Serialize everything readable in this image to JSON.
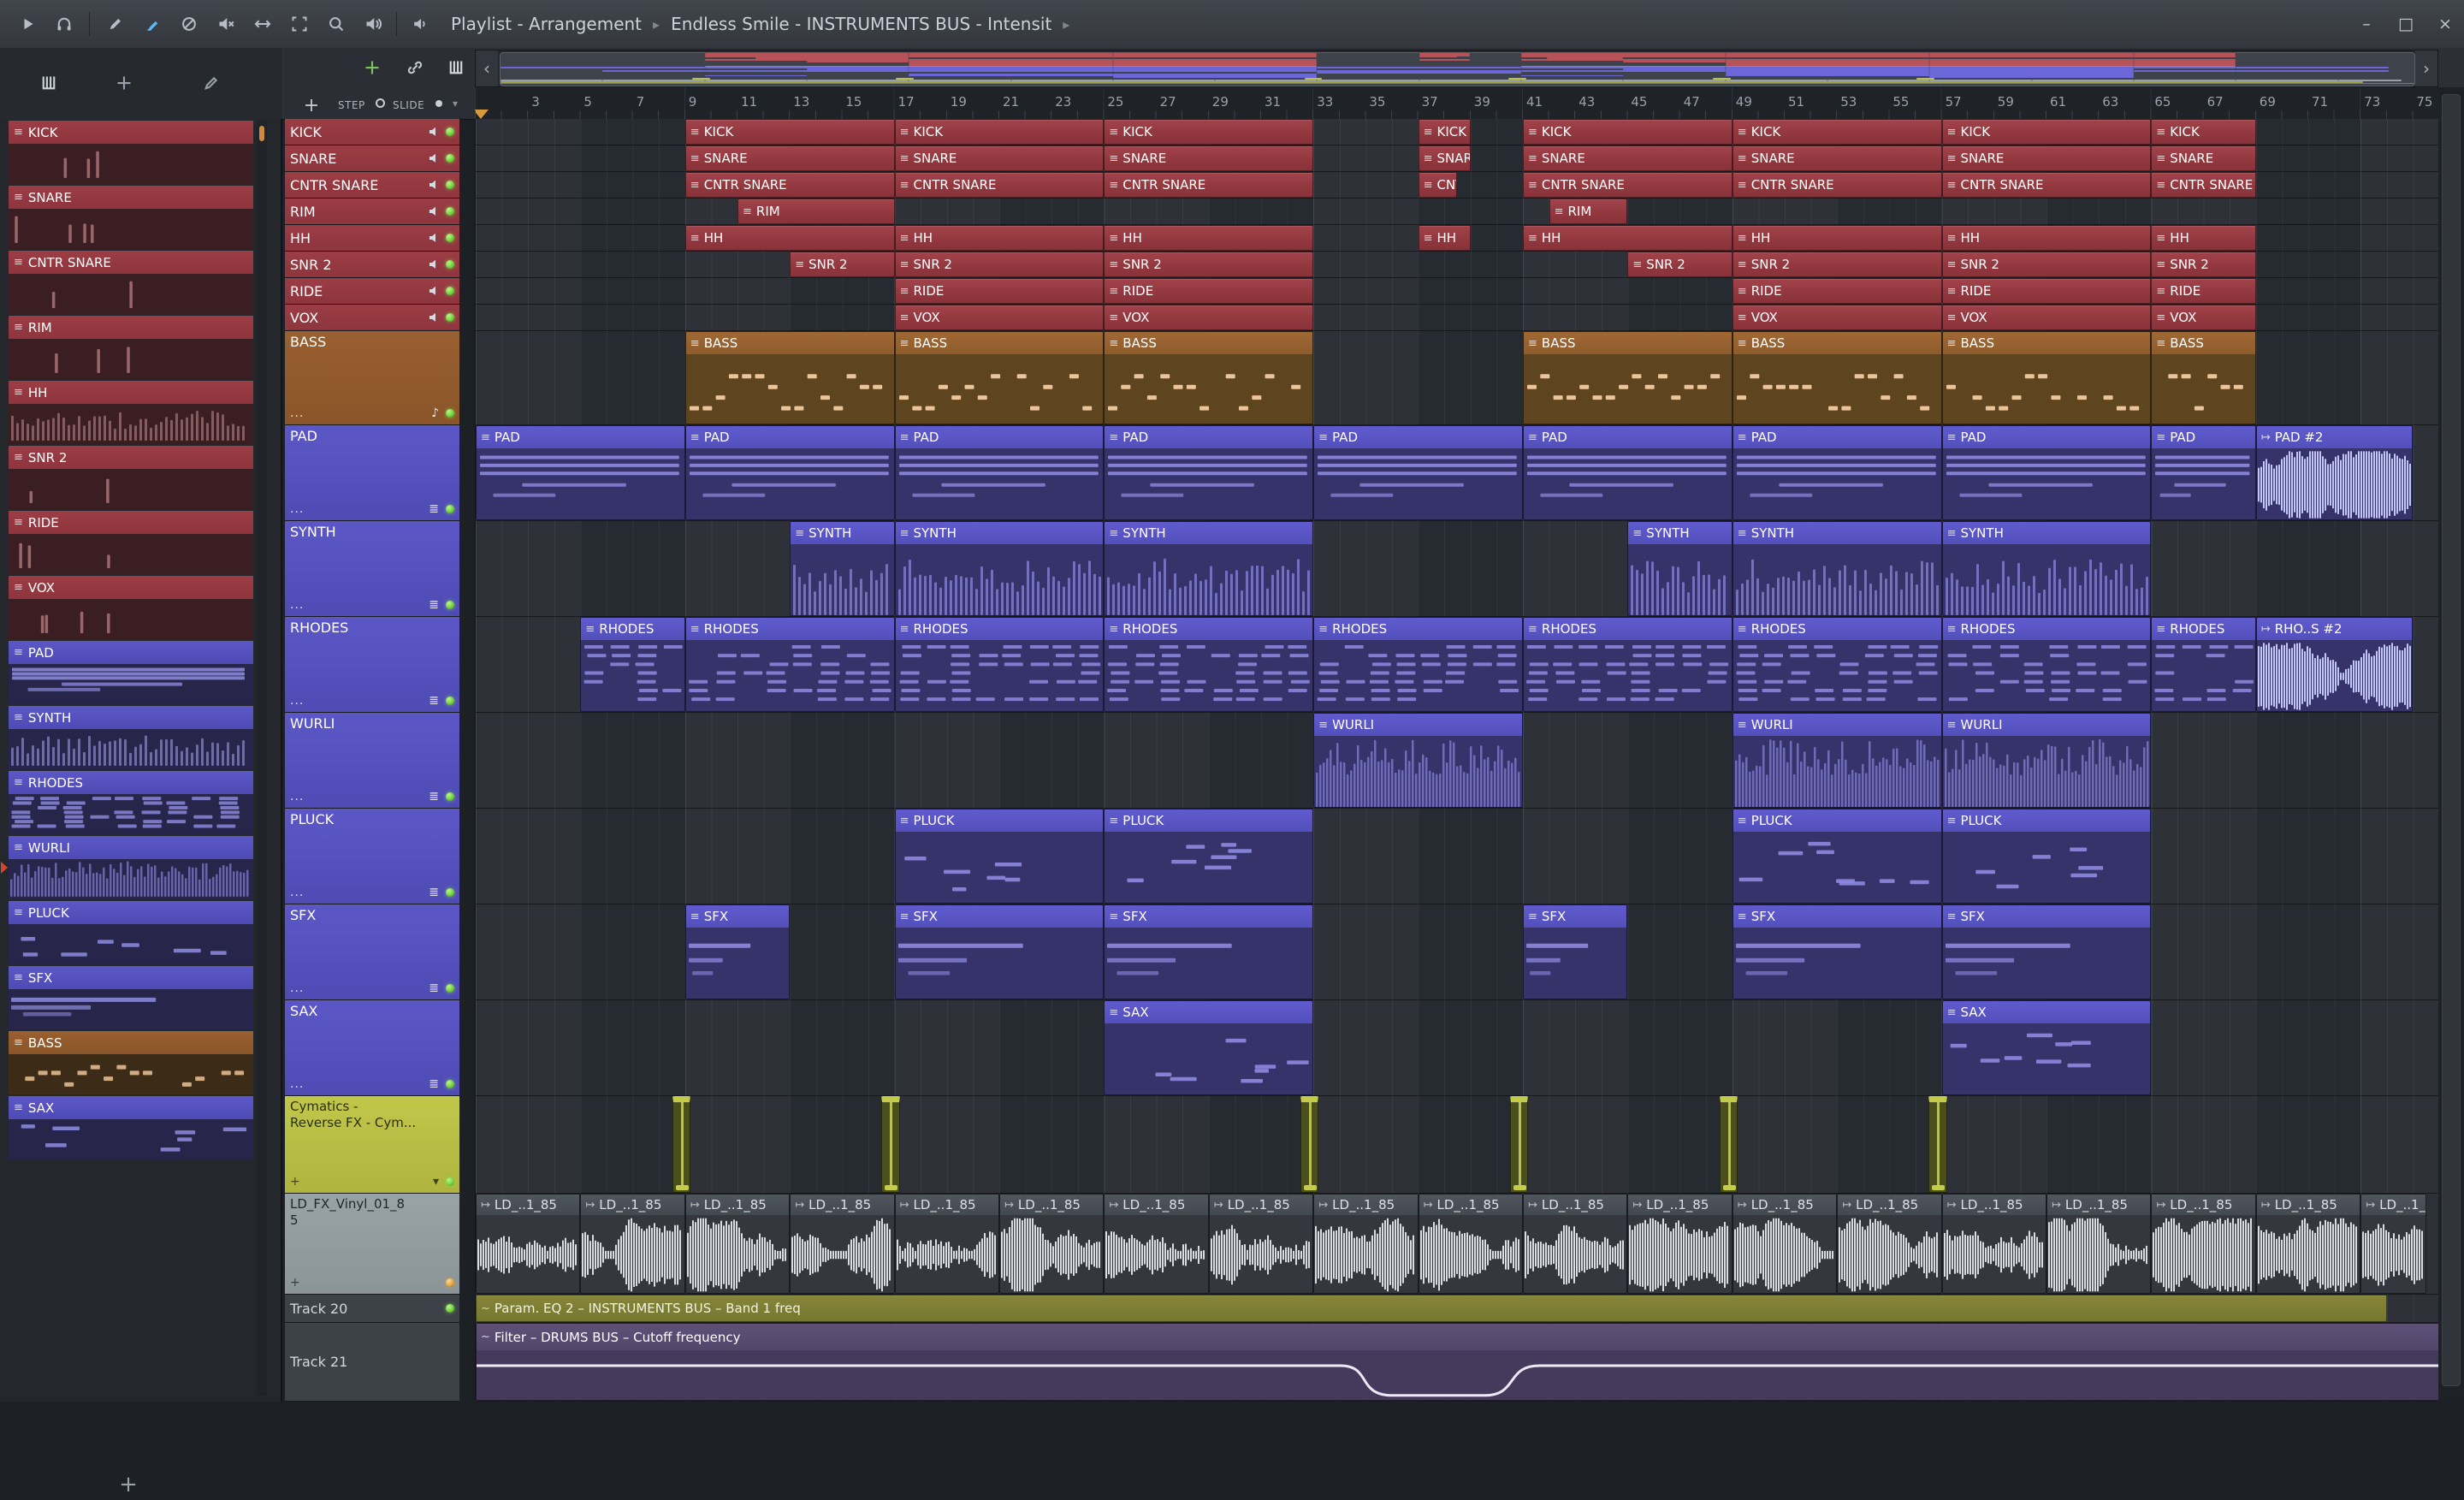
{
  "window": {
    "title_left": "Playlist - Arrangement",
    "title_mid": "Endless Smile - INSTRUMENTS BUS - Intensit",
    "chevron": "▸",
    "minimize": "–",
    "maximize": "□",
    "close": "×"
  },
  "nav": {
    "left": "‹",
    "right": "›",
    "up": "▴"
  },
  "pl_toolbar": {
    "add": "+",
    "step": "STEP",
    "slide": "SLIDE"
  },
  "timeline": {
    "numbers": [
      3,
      5,
      7,
      9,
      11,
      13,
      15,
      17,
      19,
      21,
      23,
      25,
      27,
      29,
      31,
      33,
      35,
      37,
      39,
      41,
      43,
      45,
      47,
      49,
      51,
      53,
      55,
      57,
      59,
      61,
      63,
      65,
      67,
      69,
      71,
      73,
      75
    ]
  },
  "sidebar": {
    "add_button": "+",
    "selected_item": "WURLI",
    "items": [
      {
        "name": "KICK",
        "kind": "red",
        "pv": "hits"
      },
      {
        "name": "SNARE",
        "kind": "red",
        "pv": "hits"
      },
      {
        "name": "CNTR SNARE",
        "kind": "red",
        "pv": "hits"
      },
      {
        "name": "RIM",
        "kind": "red",
        "pv": "hits"
      },
      {
        "name": "HH",
        "kind": "red",
        "pv": "ticks"
      },
      {
        "name": "SNR 2",
        "kind": "red",
        "pv": "hits"
      },
      {
        "name": "RIDE",
        "kind": "red",
        "pv": "hits"
      },
      {
        "name": "VOX",
        "kind": "red",
        "pv": "hits"
      },
      {
        "name": "PAD",
        "kind": "blue",
        "pv": "pad"
      },
      {
        "name": "SYNTH",
        "kind": "blue",
        "pv": "ticks"
      },
      {
        "name": "RHODES",
        "kind": "blue",
        "pv": "chords"
      },
      {
        "name": "WURLI",
        "kind": "blue",
        "pv": "dense"
      },
      {
        "name": "PLUCK",
        "kind": "blue",
        "pv": "sparse"
      },
      {
        "name": "SFX",
        "kind": "blue",
        "pv": "long"
      },
      {
        "name": "BASS",
        "kind": "brown",
        "pv": "bass"
      },
      {
        "name": "SAX",
        "kind": "blue",
        "pv": "sparse"
      }
    ]
  },
  "tracks": [
    {
      "name": "KICK",
      "kind": "drum",
      "h": 31,
      "led": true
    },
    {
      "name": "SNARE",
      "kind": "drum",
      "h": 31,
      "led": true
    },
    {
      "name": "CNTR SNARE",
      "kind": "drum",
      "h": 31,
      "led": true
    },
    {
      "name": "RIM",
      "kind": "drum",
      "h": 31,
      "led": true
    },
    {
      "name": "HH",
      "kind": "drum",
      "h": 31,
      "led": true
    },
    {
      "name": "SNR 2",
      "kind": "drum",
      "h": 31,
      "led": true
    },
    {
      "name": "RIDE",
      "kind": "drum",
      "h": 31,
      "led": true
    },
    {
      "name": "VOX",
      "kind": "drum",
      "h": 31,
      "led": true
    },
    {
      "name": "BASS",
      "kind": "bass",
      "h": 110,
      "led": true,
      "icon": "♪",
      "dots": "...",
      "clip_pv": "bass"
    },
    {
      "name": "PAD",
      "kind": "keys",
      "h": 112,
      "led": true,
      "icon": "≣",
      "dots": "...",
      "clip_pv": "pad"
    },
    {
      "name": "SYNTH",
      "kind": "keys",
      "h": 112,
      "led": true,
      "icon": "≣",
      "dots": "...",
      "clip_pv": "ticks"
    },
    {
      "name": "RHODES",
      "kind": "keys",
      "h": 112,
      "led": true,
      "icon": "≣",
      "dots": "...",
      "clip_pv": "chords"
    },
    {
      "name": "WURLI",
      "kind": "keys",
      "h": 112,
      "led": true,
      "icon": "≣",
      "dots": "...",
      "clip_pv": "dense"
    },
    {
      "name": "PLUCK",
      "kind": "keys",
      "h": 112,
      "led": true,
      "icon": "≣",
      "dots": "...",
      "clip_pv": "sparse"
    },
    {
      "name": "SFX",
      "kind": "keys",
      "h": 112,
      "led": true,
      "icon": "≣",
      "dots": "...",
      "clip_pv": "long"
    },
    {
      "name": "SAX",
      "kind": "keys",
      "h": 112,
      "led": true,
      "icon": "≣",
      "dots": "...",
      "clip_pv": "sparse"
    },
    {
      "name": "Cymatics - Reverse FX - Cym...",
      "label_lines": [
        "Cymatics -",
        "Reverse FX - Cym..."
      ],
      "kind": "cym",
      "h": 114,
      "led": true,
      "icon": "▾",
      "dots": "+",
      "clip_label": ""
    },
    {
      "name": "LD_FX_Vinyl_01_85",
      "label_lines": [
        "LD_FX_Vinyl_01_8",
        "5"
      ],
      "kind": "ld",
      "h": 118,
      "led": true,
      "led_color": "orange",
      "dots": "+",
      "clip_label": "LD_..1_85",
      "clip_pv": "wave"
    },
    {
      "name": "Track 20",
      "kind": "auto",
      "h": 33,
      "led": true
    },
    {
      "name": "Track 21",
      "kind": "auto",
      "h": 92,
      "led": false
    }
  ],
  "clips": [
    {
      "t": 0,
      "s": 9,
      "e": 17
    },
    {
      "t": 0,
      "s": 17,
      "e": 25
    },
    {
      "t": 0,
      "s": 25,
      "e": 33
    },
    {
      "t": 0,
      "s": 37,
      "e": 39
    },
    {
      "t": 0,
      "s": 41,
      "e": 49
    },
    {
      "t": 0,
      "s": 49,
      "e": 57
    },
    {
      "t": 0,
      "s": 57,
      "e": 65
    },
    {
      "t": 0,
      "s": 65,
      "e": 69
    },
    {
      "t": 1,
      "s": 9,
      "e": 17
    },
    {
      "t": 1,
      "s": 17,
      "e": 25
    },
    {
      "t": 1,
      "s": 25,
      "e": 33
    },
    {
      "t": 1,
      "s": 37,
      "e": 39
    },
    {
      "t": 1,
      "s": 41,
      "e": 49
    },
    {
      "t": 1,
      "s": 49,
      "e": 57
    },
    {
      "t": 1,
      "s": 57,
      "e": 65
    },
    {
      "t": 1,
      "s": 65,
      "e": 69
    },
    {
      "t": 2,
      "s": 9,
      "e": 17
    },
    {
      "t": 2,
      "s": 17,
      "e": 25
    },
    {
      "t": 2,
      "s": 25,
      "e": 33
    },
    {
      "t": 2,
      "s": 37,
      "e": 38.5,
      "l": "CNT..ARE"
    },
    {
      "t": 2,
      "s": 41,
      "e": 49
    },
    {
      "t": 2,
      "s": 49,
      "e": 57
    },
    {
      "t": 2,
      "s": 57,
      "e": 65
    },
    {
      "t": 2,
      "s": 65,
      "e": 69
    },
    {
      "t": 3,
      "s": 11,
      "e": 17
    },
    {
      "t": 3,
      "s": 42,
      "e": 45
    },
    {
      "t": 4,
      "s": 9,
      "e": 17
    },
    {
      "t": 4,
      "s": 17,
      "e": 25
    },
    {
      "t": 4,
      "s": 25,
      "e": 33
    },
    {
      "t": 4,
      "s": 37,
      "e": 39
    },
    {
      "t": 4,
      "s": 41,
      "e": 49
    },
    {
      "t": 4,
      "s": 49,
      "e": 57
    },
    {
      "t": 4,
      "s": 57,
      "e": 65
    },
    {
      "t": 4,
      "s": 65,
      "e": 69
    },
    {
      "t": 5,
      "s": 13,
      "e": 17
    },
    {
      "t": 5,
      "s": 17,
      "e": 25
    },
    {
      "t": 5,
      "s": 25,
      "e": 33
    },
    {
      "t": 5,
      "s": 45,
      "e": 49
    },
    {
      "t": 5,
      "s": 49,
      "e": 57
    },
    {
      "t": 5,
      "s": 57,
      "e": 65
    },
    {
      "t": 5,
      "s": 65,
      "e": 69
    },
    {
      "t": 6,
      "s": 17,
      "e": 25
    },
    {
      "t": 6,
      "s": 25,
      "e": 33
    },
    {
      "t": 6,
      "s": 49,
      "e": 57
    },
    {
      "t": 6,
      "s": 57,
      "e": 65
    },
    {
      "t": 6,
      "s": 65,
      "e": 69
    },
    {
      "t": 7,
      "s": 17,
      "e": 25
    },
    {
      "t": 7,
      "s": 25,
      "e": 33
    },
    {
      "t": 7,
      "s": 49,
      "e": 57
    },
    {
      "t": 7,
      "s": 57,
      "e": 65
    },
    {
      "t": 7,
      "s": 65,
      "e": 69
    },
    {
      "t": 8,
      "s": 9,
      "e": 17
    },
    {
      "t": 8,
      "s": 17,
      "e": 25
    },
    {
      "t": 8,
      "s": 25,
      "e": 33
    },
    {
      "t": 8,
      "s": 41,
      "e": 49
    },
    {
      "t": 8,
      "s": 49,
      "e": 57
    },
    {
      "t": 8,
      "s": 57,
      "e": 65
    },
    {
      "t": 8,
      "s": 65,
      "e": 69
    },
    {
      "t": 9,
      "s": 1,
      "e": 9
    },
    {
      "t": 9,
      "s": 9,
      "e": 17
    },
    {
      "t": 9,
      "s": 17,
      "e": 25
    },
    {
      "t": 9,
      "s": 25,
      "e": 33
    },
    {
      "t": 9,
      "s": 33,
      "e": 41
    },
    {
      "t": 9,
      "s": 41,
      "e": 49
    },
    {
      "t": 9,
      "s": 49,
      "e": 57
    },
    {
      "t": 9,
      "s": 57,
      "e": 65
    },
    {
      "t": 9,
      "s": 65,
      "e": 69
    },
    {
      "t": 9,
      "s": 69,
      "e": 75,
      "l": "PAD #2",
      "k": "audio",
      "p": "wave"
    },
    {
      "t": 10,
      "s": 13,
      "e": 17
    },
    {
      "t": 10,
      "s": 17,
      "e": 25
    },
    {
      "t": 10,
      "s": 25,
      "e": 33
    },
    {
      "t": 10,
      "s": 45,
      "e": 49
    },
    {
      "t": 10,
      "s": 49,
      "e": 57
    },
    {
      "t": 10,
      "s": 57,
      "e": 65
    },
    {
      "t": 11,
      "s": 5,
      "e": 9
    },
    {
      "t": 11,
      "s": 9,
      "e": 17
    },
    {
      "t": 11,
      "s": 17,
      "e": 25
    },
    {
      "t": 11,
      "s": 25,
      "e": 33
    },
    {
      "t": 11,
      "s": 33,
      "e": 41
    },
    {
      "t": 11,
      "s": 41,
      "e": 49
    },
    {
      "t": 11,
      "s": 49,
      "e": 57
    },
    {
      "t": 11,
      "s": 57,
      "e": 65
    },
    {
      "t": 11,
      "s": 65,
      "e": 69
    },
    {
      "t": 11,
      "s": 69,
      "e": 75,
      "l": "RHO..S #2",
      "k": "audio",
      "p": "wave"
    },
    {
      "t": 12,
      "s": 33,
      "e": 41
    },
    {
      "t": 12,
      "s": 49,
      "e": 57
    },
    {
      "t": 12,
      "s": 57,
      "e": 65
    },
    {
      "t": 13,
      "s": 17,
      "e": 25
    },
    {
      "t": 13,
      "s": 25,
      "e": 33
    },
    {
      "t": 13,
      "s": 49,
      "e": 57
    },
    {
      "t": 13,
      "s": 57,
      "e": 65
    },
    {
      "t": 14,
      "s": 9,
      "e": 13
    },
    {
      "t": 14,
      "s": 17,
      "e": 25
    },
    {
      "t": 14,
      "s": 25,
      "e": 33
    },
    {
      "t": 14,
      "s": 41,
      "e": 45
    },
    {
      "t": 14,
      "s": 49,
      "e": 57
    },
    {
      "t": 14,
      "s": 57,
      "e": 65
    },
    {
      "t": 15,
      "s": 25,
      "e": 33
    },
    {
      "t": 15,
      "s": 57,
      "e": 65
    },
    {
      "t": 16,
      "s": 8.5,
      "e": 9.2
    },
    {
      "t": 16,
      "s": 16.5,
      "e": 17.2
    },
    {
      "t": 16,
      "s": 32.5,
      "e": 33.2
    },
    {
      "t": 16,
      "s": 40.5,
      "e": 41.2
    },
    {
      "t": 16,
      "s": 48.5,
      "e": 49.2
    },
    {
      "t": 16,
      "s": 56.5,
      "e": 57.2
    },
    {
      "t": 17,
      "s": 1,
      "e": 5
    },
    {
      "t": 17,
      "s": 5,
      "e": 9
    },
    {
      "t": 17,
      "s": 9,
      "e": 13
    },
    {
      "t": 17,
      "s": 13,
      "e": 17
    },
    {
      "t": 17,
      "s": 17,
      "e": 21
    },
    {
      "t": 17,
      "s": 21,
      "e": 25
    },
    {
      "t": 17,
      "s": 25,
      "e": 29
    },
    {
      "t": 17,
      "s": 29,
      "e": 33
    },
    {
      "t": 17,
      "s": 33,
      "e": 37
    },
    {
      "t": 17,
      "s": 37,
      "e": 41
    },
    {
      "t": 17,
      "s": 41,
      "e": 45
    },
    {
      "t": 17,
      "s": 45,
      "e": 49
    },
    {
      "t": 17,
      "s": 49,
      "e": 53
    },
    {
      "t": 17,
      "s": 53,
      "e": 57
    },
    {
      "t": 17,
      "s": 57,
      "e": 61
    },
    {
      "t": 17,
      "s": 61,
      "e": 65
    },
    {
      "t": 17,
      "s": 65,
      "e": 69
    },
    {
      "t": 17,
      "s": 69,
      "e": 73
    },
    {
      "t": 17,
      "s": 73,
      "e": 75.5
    },
    {
      "t": 18,
      "s": 1,
      "e": 74,
      "l": "Param. EQ 2 – INSTRUMENTS BUS – Band 1 freq",
      "k": "ao"
    },
    {
      "t": 19,
      "s": 1,
      "e": 76,
      "l": "Filter – DRUMS BUS – Cutoff frequency",
      "k": "ap",
      "p": "curve"
    }
  ],
  "colors": {
    "red": "#953a41",
    "brown": "#925a2d",
    "blue": "#5551bd",
    "cym": "#b9c04a",
    "ld": "#8e999d",
    "led_green": "#86e34b",
    "led_orange": "#e0a03c",
    "accent_blue": "#5fb7ef",
    "note_peach": "#f1cba1",
    "note_blue": "#8d8ae0",
    "wave": "#c3c7f7",
    "wave_ld": "#d9dde2",
    "auto_olive": "#7c7d32",
    "auto_plum": "#584a72"
  }
}
